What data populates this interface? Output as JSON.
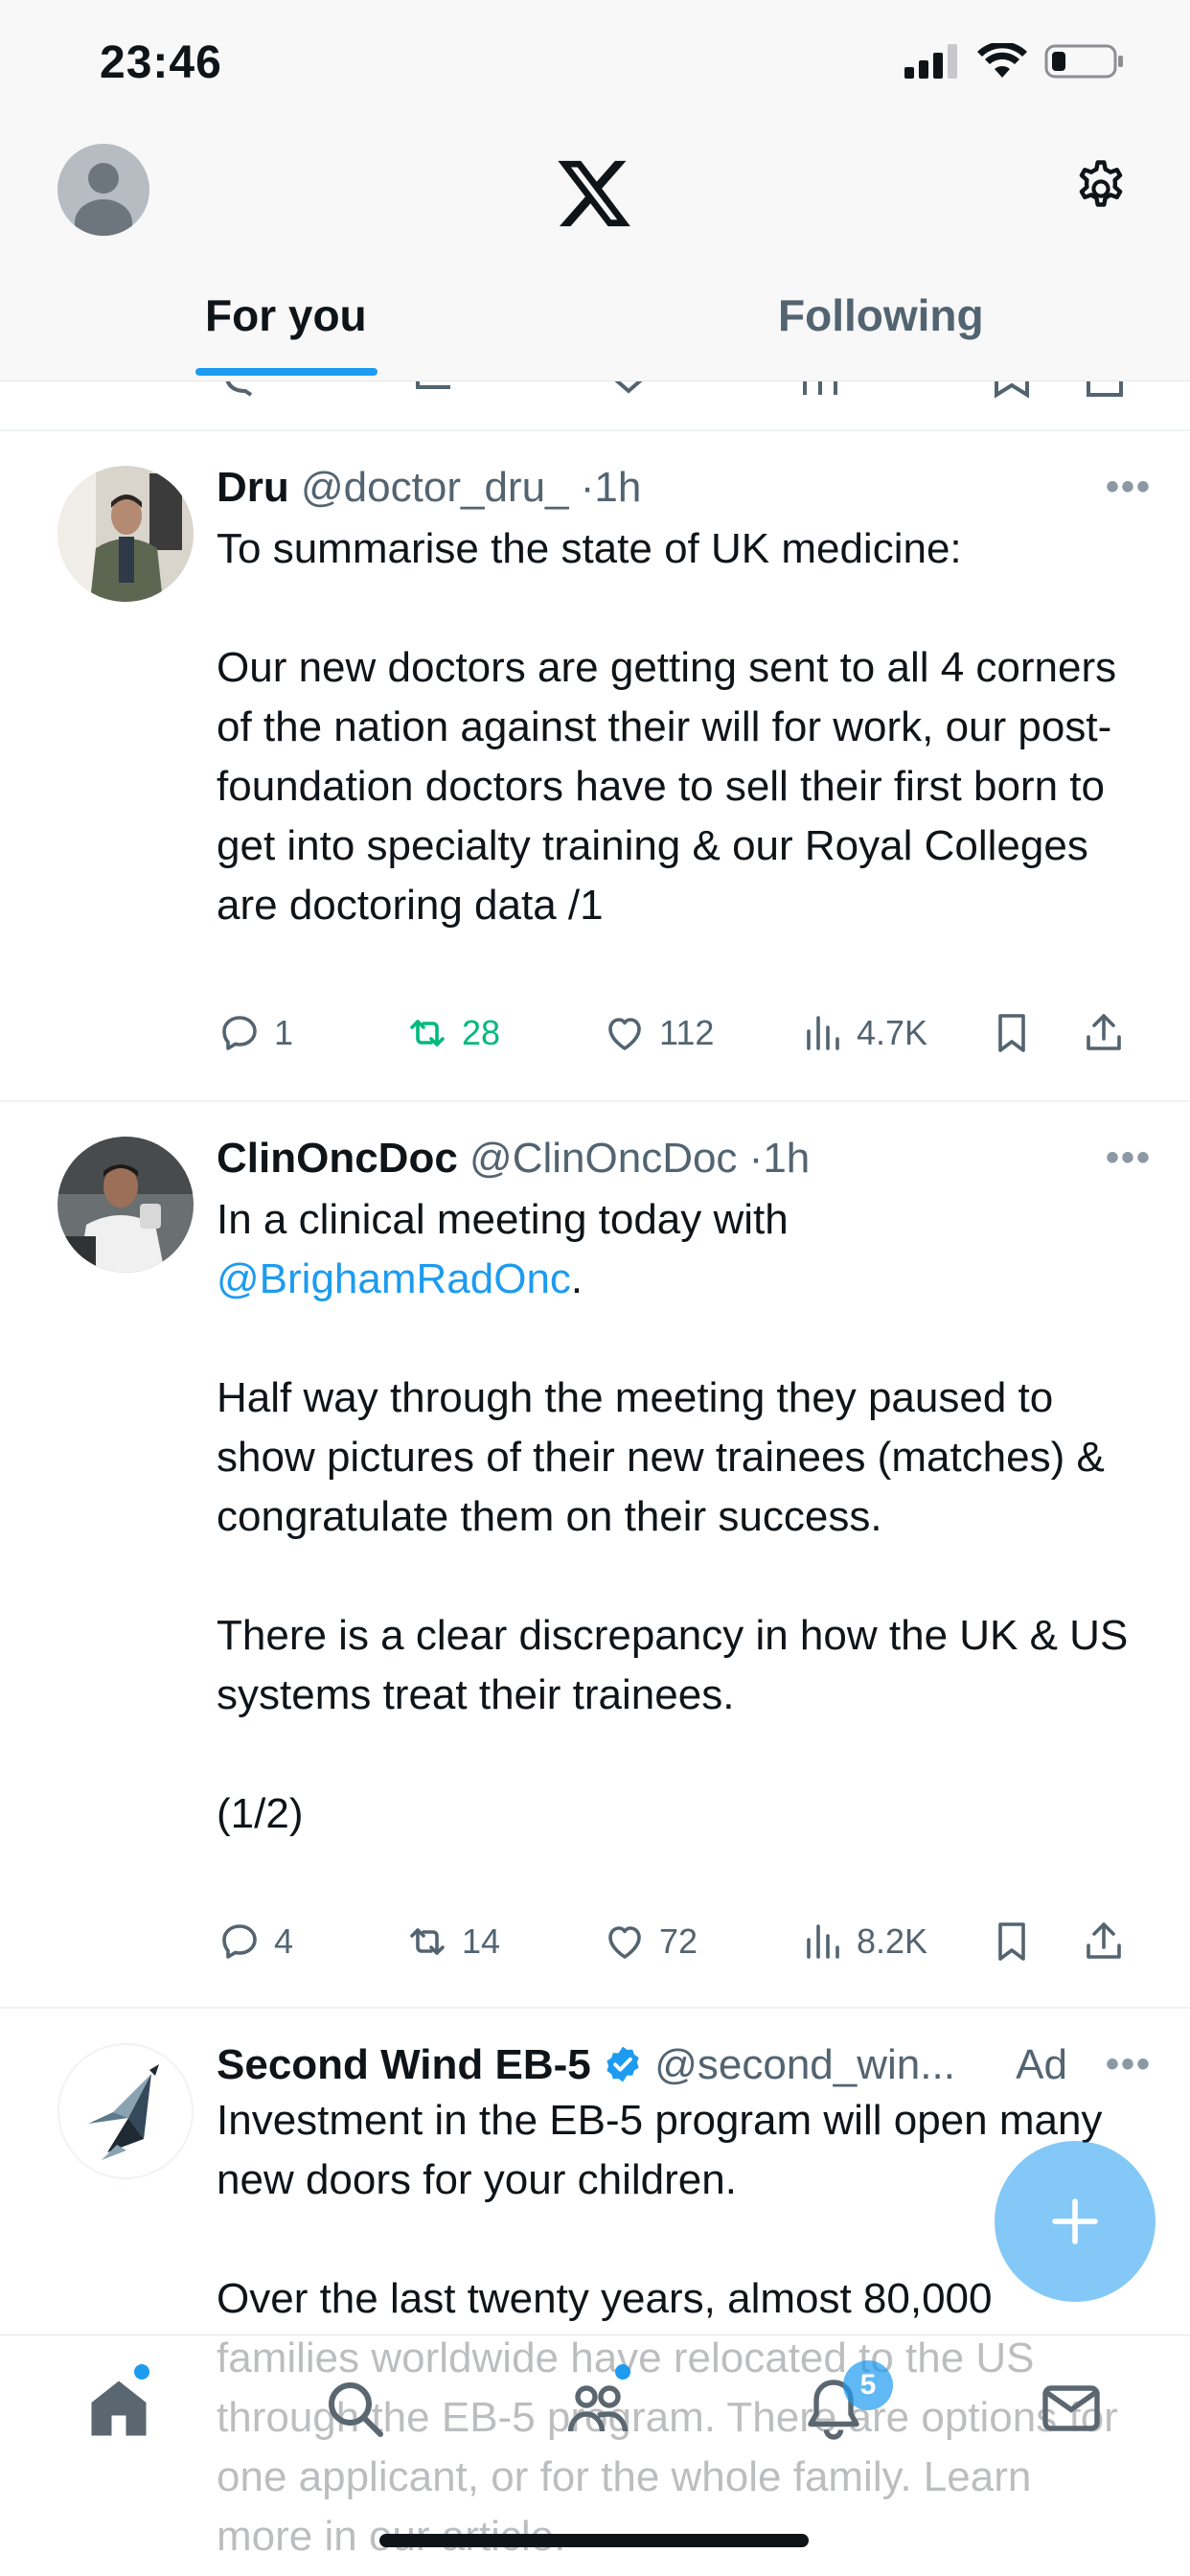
{
  "status_bar": {
    "time": "23:46"
  },
  "header": {
    "tabs": [
      {
        "label": "For you",
        "active": true
      },
      {
        "label": "Following",
        "active": false
      }
    ]
  },
  "tweets": [
    {
      "name": "Dru",
      "handle": "@doctor_dru_",
      "time": "1h",
      "text": "To summarise the state of UK medicine:\n\nOur new doctors are getting sent to all 4 corners of the nation against their will for work, our post-foundation doctors have to sell their first born to get into specialty training & our Royal Colleges are doctoring data /1",
      "replies": "1",
      "reposts": "28",
      "likes": "112",
      "views": "4.7K"
    },
    {
      "name": "ClinOncDoc",
      "handle": "@ClinOncDoc",
      "time": "1h",
      "text_line1": "In a clinical meeting today with",
      "mention": "@BrighamRadOnc",
      "text_rest": "Half way through the meeting they paused to show pictures of their new trainees (matches) & congratulate them on their success.\n\nThere is a clear discrepancy in how the UK & US systems treat their trainees.\n\n(1/2)",
      "replies": "4",
      "reposts": "14",
      "likes": "72",
      "views": "8.2K"
    },
    {
      "name": "Second Wind EB-5",
      "handle": "@second_win...",
      "ad_label": "Ad",
      "verified": true,
      "text": "Investment in the EB-5 program will open many new doors for your children.\n\nOver the last twenty years, almost 80,000 families worldwide have relocated to the US through the EB-5 program. There are options for one applicant, or for the whole family. Learn more in our article."
    }
  ],
  "bottom_nav": {
    "notifications_badge": "5"
  },
  "colors": {
    "accent": "#1d9bf0",
    "repost_active": "#00ba7c",
    "muted": "#536471"
  }
}
